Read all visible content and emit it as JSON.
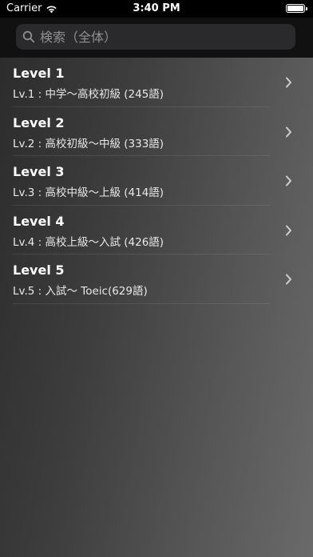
{
  "status_bar": {
    "carrier": "Carrier",
    "time": "3:40 PM",
    "battery_level": 1.0
  },
  "search": {
    "placeholder": "検索（全体）",
    "value": ""
  },
  "levels": [
    {
      "title": "Level 1",
      "subtitle": "Lv.1 : 中学～高校初級 (245語)"
    },
    {
      "title": "Level 2",
      "subtitle": "Lv.2 : 高校初級～中級 (333語)"
    },
    {
      "title": "Level 3",
      "subtitle": "Lv.3 : 高校中級～上級 (414語)"
    },
    {
      "title": "Level 4",
      "subtitle": "Lv.4 : 高校上級～入試 (426語)"
    },
    {
      "title": "Level 5",
      "subtitle": "Lv.5 : 入試～ Toeic(629語)"
    }
  ],
  "icons": {
    "wifi": "wifi-icon",
    "battery": "battery-icon",
    "search": "search-icon",
    "chevron": "chevron-right-icon"
  },
  "colors": {
    "background_gradient_start": "#2b2b2b",
    "background_gradient_end": "#6a6a6a",
    "search_field": "#2a2a2c",
    "placeholder": "#8e8e93",
    "chevron": "#d0d0d0"
  }
}
